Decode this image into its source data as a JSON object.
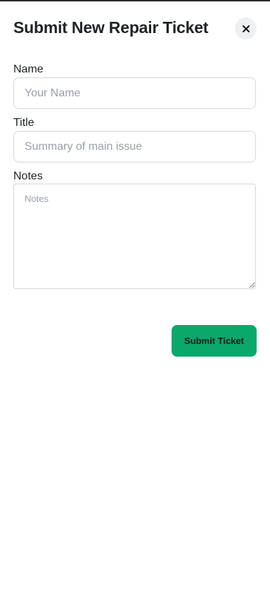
{
  "modal": {
    "title": "Submit New Repair Ticket",
    "close_icon": "close-icon"
  },
  "form": {
    "name": {
      "label": "Name",
      "value": "",
      "placeholder": "Your Name"
    },
    "title": {
      "label": "Title",
      "value": "",
      "placeholder": "Summary of main issue"
    },
    "notes": {
      "label": "Notes",
      "value": "",
      "placeholder": "Notes"
    },
    "submit_label": "Submit Ticket"
  },
  "colors": {
    "submit_button": "#0aa86b",
    "close_button_bg": "#eef0f2",
    "input_border": "#d4d7dc",
    "placeholder": "#98a0aa"
  }
}
